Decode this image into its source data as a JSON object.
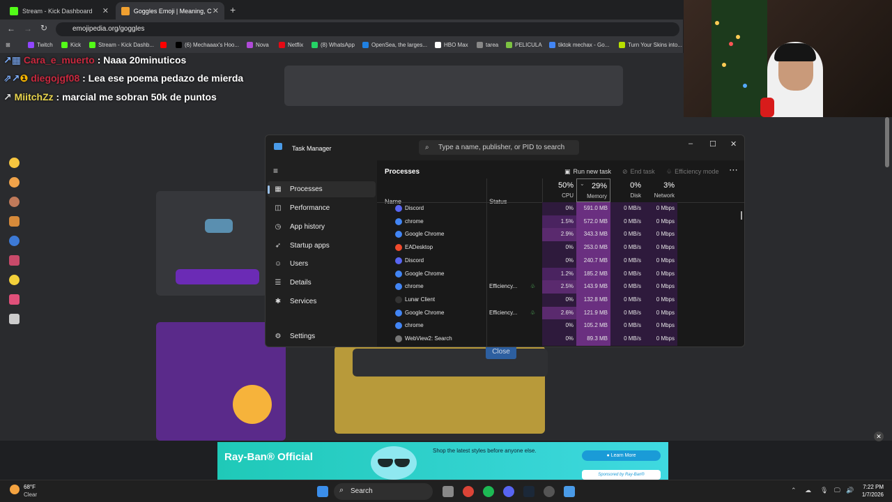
{
  "browser": {
    "tabs": [
      {
        "label": "Stream - Kick Dashboard",
        "color": "#53fc18"
      },
      {
        "label": "Goggles Emoji | Meaning, C",
        "color": "#f0a030"
      }
    ],
    "url": "emojipedia.org/goggles",
    "bookmarks": [
      {
        "label": "Twitch",
        "color": "#9146ff"
      },
      {
        "label": "Kick",
        "color": "#53fc18"
      },
      {
        "label": "Stream - Kick Dashb...",
        "color": "#53fc18"
      },
      {
        "label": "",
        "color": "#ff0000"
      },
      {
        "label": "(6) Mechaaax's Hoo...",
        "color": "#000000"
      },
      {
        "label": "Nova",
        "color": "#b04ad8"
      },
      {
        "label": "Netflix",
        "color": "#e50914"
      },
      {
        "label": "(8) WhatsApp",
        "color": "#25d366"
      },
      {
        "label": "OpenSea, the larges...",
        "color": "#2081e2"
      },
      {
        "label": "HBO Max",
        "color": "#ffffff"
      },
      {
        "label": "tarea",
        "color": "#888888"
      },
      {
        "label": "PELICULA",
        "color": "#7cc242"
      },
      {
        "label": "tiktok mechax - Go...",
        "color": "#4285f4"
      },
      {
        "label": "Turn Your Skins into...",
        "color": "#b8e000"
      }
    ]
  },
  "chat": [
    {
      "user": "Cara_e_muerto",
      "message": ": Naaa 20minuticos"
    },
    {
      "user": "diegojgf08",
      "message": ": Lea ese poema pedazo de mierda"
    },
    {
      "user": "MiitchZz",
      "message": ": marcial me sobran 50k de puntos"
    }
  ],
  "task_manager": {
    "title": "Task Manager",
    "search_placeholder": "Type a name, publisher, or PID to search",
    "nav": [
      {
        "label": "Processes",
        "icon": "grid-icon"
      },
      {
        "label": "Performance",
        "icon": "pulse-icon"
      },
      {
        "label": "App history",
        "icon": "history-icon"
      },
      {
        "label": "Startup apps",
        "icon": "rocket-icon"
      },
      {
        "label": "Users",
        "icon": "users-icon"
      },
      {
        "label": "Details",
        "icon": "list-icon"
      },
      {
        "label": "Services",
        "icon": "puzzle-icon"
      }
    ],
    "settings_label": "Settings",
    "section_title": "Processes",
    "toolbar": {
      "run_new_task": "Run new task",
      "end_task": "End task",
      "efficiency_mode": "Efficiency mode"
    },
    "columns": {
      "name": "Name",
      "status": "Status",
      "cpu_pct": "50%",
      "cpu": "CPU",
      "memory_pct": "29%",
      "memory": "Memory",
      "disk_pct": "0%",
      "disk": "Disk",
      "network_pct": "3%",
      "network": "Network"
    },
    "processes": [
      {
        "name": "Discord",
        "status": "",
        "cpu": "0%",
        "memory": "591.0 MB",
        "disk": "0 MB/s",
        "network": "0 Mbps",
        "icon_color": "#5865f2"
      },
      {
        "name": "chrome",
        "status": "",
        "cpu": "1.5%",
        "memory": "572.0 MB",
        "disk": "0 MB/s",
        "network": "0 Mbps",
        "icon_color": "#4285f4"
      },
      {
        "name": "Google Chrome",
        "status": "",
        "cpu": "2.9%",
        "memory": "343.3 MB",
        "disk": "0 MB/s",
        "network": "0 Mbps",
        "icon_color": "#4285f4"
      },
      {
        "name": "EADesktop",
        "status": "",
        "cpu": "0%",
        "memory": "253.0 MB",
        "disk": "0 MB/s",
        "network": "0 Mbps",
        "icon_color": "#f04a2c"
      },
      {
        "name": "Discord",
        "status": "",
        "cpu": "0%",
        "memory": "240.7 MB",
        "disk": "0 MB/s",
        "network": "0 Mbps",
        "icon_color": "#5865f2"
      },
      {
        "name": "Google Chrome",
        "status": "",
        "cpu": "1.2%",
        "memory": "185.2 MB",
        "disk": "0 MB/s",
        "network": "0 Mbps",
        "icon_color": "#4285f4"
      },
      {
        "name": "chrome",
        "status": "Efficiency...",
        "cpu": "2.5%",
        "memory": "143.9 MB",
        "disk": "0 MB/s",
        "network": "0 Mbps",
        "icon_color": "#4285f4"
      },
      {
        "name": "Lunar Client",
        "status": "",
        "cpu": "0%",
        "memory": "132.8 MB",
        "disk": "0 MB/s",
        "network": "0 Mbps",
        "icon_color": "#333333"
      },
      {
        "name": "Google Chrome",
        "status": "Efficiency...",
        "cpu": "2.6%",
        "memory": "121.9 MB",
        "disk": "0 MB/s",
        "network": "0 Mbps",
        "icon_color": "#4285f4"
      },
      {
        "name": "chrome",
        "status": "",
        "cpu": "0%",
        "memory": "105.2 MB",
        "disk": "0 MB/s",
        "network": "0 Mbps",
        "icon_color": "#4285f4"
      },
      {
        "name": "WebView2: Search",
        "status": "",
        "cpu": "0%",
        "memory": "89.3 MB",
        "disk": "0 MB/s",
        "network": "0 Mbps",
        "icon_color": "#777777"
      }
    ]
  },
  "page": {
    "close_button": "Close"
  },
  "ad": {
    "brand": "Ray-Ban® Official",
    "tagline": "Shop the latest styles before anyone else.",
    "cta": "Learn More",
    "sponsor": "Sponsored by Ray-Ban®"
  },
  "taskbar": {
    "weather_temp": "68°F",
    "weather_cond": "Clear",
    "search_label": "Search",
    "time": "7:22 PM",
    "date": "1/7/2026"
  }
}
